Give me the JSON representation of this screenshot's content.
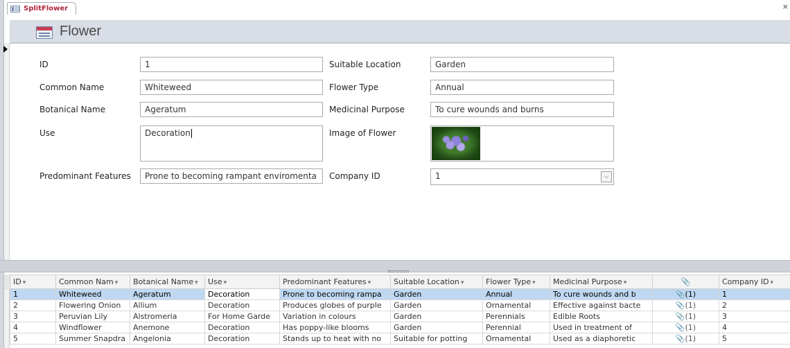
{
  "tab": {
    "title": "SplitFlower",
    "close_glyph": "×"
  },
  "form": {
    "title": "Flower",
    "fields": {
      "id": {
        "label": "ID",
        "value": "1"
      },
      "common_name": {
        "label": "Common Name",
        "value": "Whiteweed"
      },
      "botanical_name": {
        "label": "Botanical Name",
        "value": "Ageratum"
      },
      "use": {
        "label": "Use",
        "value": "Decoration"
      },
      "predominant_features": {
        "label": "Predominant Features",
        "value": "Prone to becoming rampant enviromenta"
      },
      "suitable_location": {
        "label": "Suitable Location",
        "value": "Garden"
      },
      "flower_type": {
        "label": "Flower Type",
        "value": "Annual"
      },
      "medicinal_purpose": {
        "label": "Medicinal Purpose",
        "value": "To cure wounds and burns"
      },
      "image": {
        "label": "Image of Flower"
      },
      "company_id": {
        "label": "Company ID",
        "value": "1"
      }
    }
  },
  "datasheet": {
    "columns": [
      {
        "label": "ID",
        "sort": "▾"
      },
      {
        "label": "Common Nam",
        "sort": "▾"
      },
      {
        "label": "Botanical Name",
        "sort": "▾"
      },
      {
        "label": "Use",
        "sort": "▾"
      },
      {
        "label": "Predominant Features",
        "sort": "▾"
      },
      {
        "label": "Suitable Location",
        "sort": "▾"
      },
      {
        "label": "Flower Type",
        "sort": "▾"
      },
      {
        "label": "Medicinal Purpose",
        "sort": "▾"
      },
      {
        "label": "📎",
        "sort": ""
      },
      {
        "label": "Company ID",
        "sort": "▾"
      }
    ],
    "rows": [
      [
        "1",
        "Whiteweed",
        "Ageratum",
        "Decoration",
        "Prone to becoming rampa",
        "Garden",
        "Annual",
        "To cure wounds and b",
        "📎(1)",
        "1"
      ],
      [
        "2",
        "Flowering Onion",
        "Allium",
        "Decoration",
        "Produces globes of purple",
        "Garden",
        "Ornamental",
        "Effective against bacte",
        "📎(1)",
        "2"
      ],
      [
        "3",
        "Peruvian Lily",
        "Alstromeria",
        "For Home Garde",
        "Variation in colours",
        "Garden",
        "Perennials",
        "Edible Roots",
        "📎(1)",
        "3"
      ],
      [
        "4",
        "Windflower",
        "Anemone",
        "Decoration",
        "Has poppy-like blooms",
        "Garden",
        "Perennial",
        "Used in treatment of",
        "📎(1)",
        "4"
      ],
      [
        "5",
        "Summer Snapdra",
        "Angelonia",
        "Decoration",
        "Stands up to heat with no",
        "Suitable for potting",
        "Ornamental",
        "Used as a diaphoretic",
        "📎(1)",
        "5"
      ]
    ]
  }
}
